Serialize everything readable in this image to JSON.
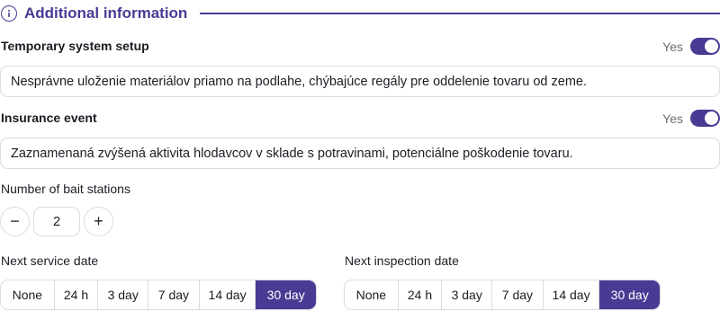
{
  "section": {
    "title": "Additional information",
    "icon": "info-icon",
    "accent_color": "#4b3a93"
  },
  "temporary_setup": {
    "label": "Temporary system setup",
    "toggle_label": "Yes",
    "toggle_on": true,
    "value": "Nesprávne uloženie materiálov priamo na podlahe, chýbajúce regály pre oddelenie tovaru od zeme."
  },
  "insurance_event": {
    "label": "Insurance event",
    "toggle_label": "Yes",
    "toggle_on": true,
    "value": "Zaznamenaná zvýšená aktivita hlodavcov v sklade s potravinami, potenciálne poškodenie tovaru."
  },
  "bait_stations": {
    "label": "Number of bait stations",
    "minus": "−",
    "plus": "+",
    "value": "2"
  },
  "next_service": {
    "label": "Next service date",
    "options": [
      "None",
      "24 h",
      "3 day",
      "7 day",
      "14 day",
      "30 day"
    ],
    "selected": "30 day"
  },
  "next_inspection": {
    "label": "Next inspection date",
    "options": [
      "None",
      "24 h",
      "3 day",
      "7 day",
      "14 day",
      "30 day"
    ],
    "selected": "30 day"
  }
}
